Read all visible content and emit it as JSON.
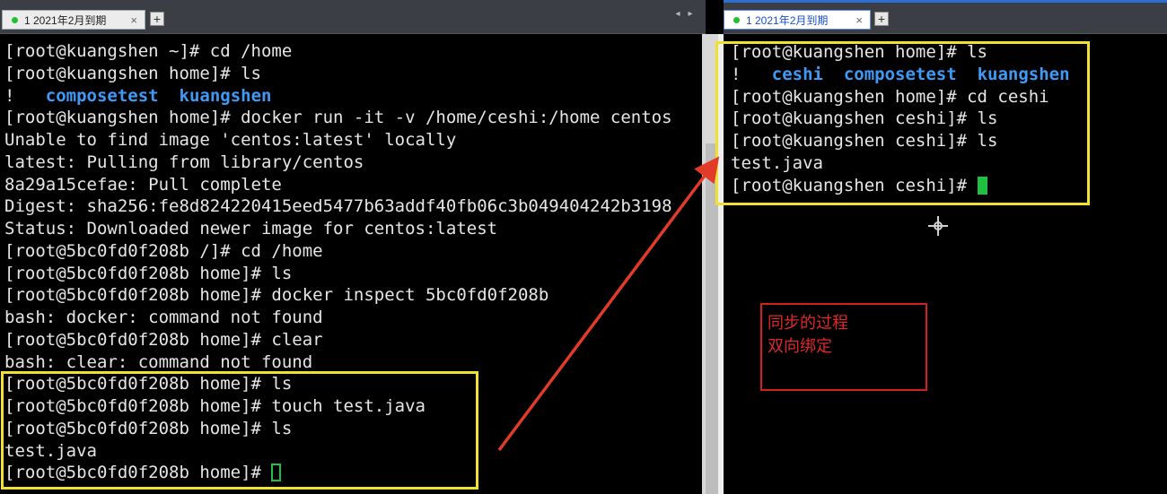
{
  "left_pane": {
    "tab_label": "1 2021年2月到期",
    "add_tab": "+",
    "lines": [
      {
        "text": "[root@kuangshen ~]# cd /home"
      },
      {
        "text": "[root@kuangshen home]# ls"
      },
      {
        "prefix": "!   ",
        "dirs": [
          "composetest",
          "kuangshen"
        ]
      },
      {
        "text": "[root@kuangshen home]# docker run -it -v /home/ceshi:/home centos"
      },
      {
        "text": "Unable to find image 'centos:latest' locally"
      },
      {
        "text": "latest: Pulling from library/centos"
      },
      {
        "text": "8a29a15cefae: Pull complete"
      },
      {
        "text": "Digest: sha256:fe8d824220415eed5477b63addf40fb06c3b049404242b3198"
      },
      {
        "text": "Status: Downloaded newer image for centos:latest"
      },
      {
        "text": "[root@5bc0fd0f208b /]# cd /home"
      },
      {
        "text": "[root@5bc0fd0f208b home]# ls"
      },
      {
        "text": "[root@5bc0fd0f208b home]# docker inspect 5bc0fd0f208b"
      },
      {
        "text": "bash: docker: command not found"
      },
      {
        "text": "[root@5bc0fd0f208b home]# clear"
      },
      {
        "text": "bash: clear: command not found"
      },
      {
        "text": "[root@5bc0fd0f208b home]# ls"
      },
      {
        "text": "[root@5bc0fd0f208b home]# touch test.java"
      },
      {
        "text": "[root@5bc0fd0f208b home]# ls"
      },
      {
        "text": "test.java"
      },
      {
        "text": "[root@5bc0fd0f208b home]# ",
        "cursor": "hollow"
      }
    ]
  },
  "right_pane": {
    "tab_label": "1 2021年2月到期",
    "add_tab": "+",
    "nav_arrows": "◂ ▸",
    "lines": [
      {
        "text": "[root@kuangshen home]# ls"
      },
      {
        "prefix": "!   ",
        "dirs": [
          "ceshi",
          "composetest",
          "kuangshen"
        ]
      },
      {
        "text": "[root@kuangshen home]# cd ceshi"
      },
      {
        "text": "[root@kuangshen ceshi]# ls"
      },
      {
        "text": "[root@kuangshen ceshi]# ls"
      },
      {
        "text": "test.java"
      },
      {
        "text": "[root@kuangshen ceshi]# ",
        "cursor": "solid"
      }
    ]
  },
  "annotation": {
    "line1": "同步的过程",
    "line2": "双向绑定"
  },
  "colors": {
    "terminal_bg": "#000000",
    "terminal_fg": "#e6e6e6",
    "directory": "#3f9af5",
    "cursor": "#20c040",
    "highlight_box": "#f0e030",
    "annotation": "#e02828"
  }
}
